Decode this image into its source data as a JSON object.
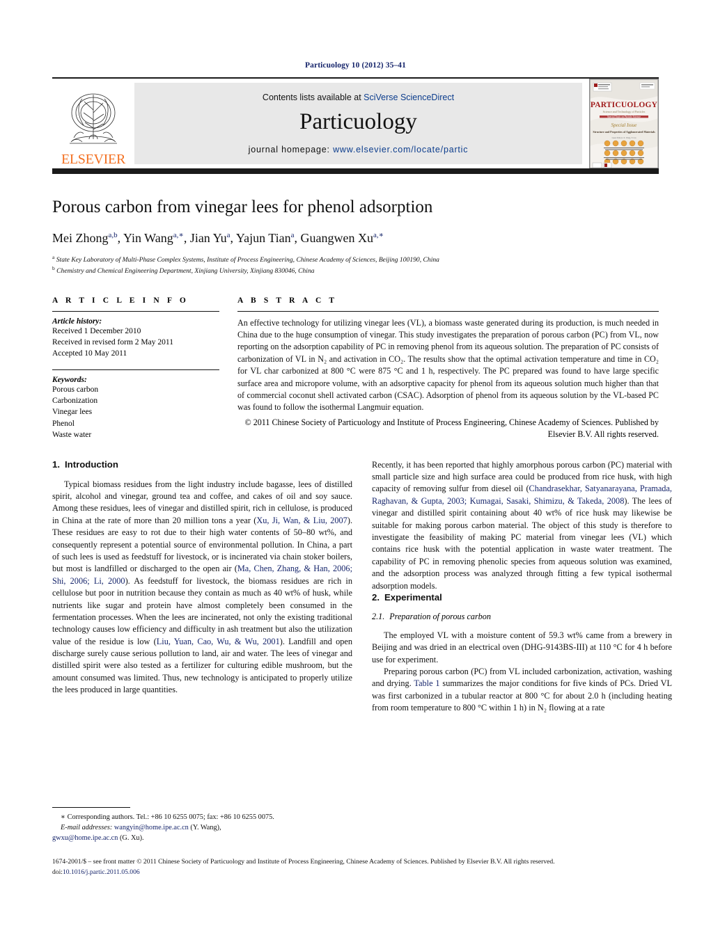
{
  "running_head": "Particuology 10 (2012) 35–41",
  "masthead": {
    "publisher_name": "ELSEVIER",
    "contents_prefix": "Contents lists available at ",
    "contents_link": "SciVerse ScienceDirect",
    "journal_title": "Particuology",
    "homepage_prefix": "journal homepage:",
    "homepage_url": "www.elsevier.com/locate/partic",
    "cover_title": "PARTICUOLOGY",
    "cover_subtitle": "Science and Technology of Particles",
    "cover_issue_label": "Special Issue"
  },
  "article": {
    "title": "Porous carbon from vinegar lees for phenol adsorption",
    "authors": [
      {
        "name": "Mei Zhong",
        "sup": "a,b"
      },
      {
        "name": "Yin Wang",
        "sup": "a,∗"
      },
      {
        "name": "Jian Yu",
        "sup": "a"
      },
      {
        "name": "Yajun Tian",
        "sup": "a"
      },
      {
        "name": "Guangwen Xu",
        "sup": "a,∗"
      }
    ],
    "affiliations": [
      {
        "marker": "a",
        "text": "State Key Laboratory of Multi-Phase Complex Systems, Institute of Process Engineering, Chinese Academy of Sciences, Beijing 100190, China"
      },
      {
        "marker": "b",
        "text": "Chemistry and Chemical Engineering Department, Xinjiang University, Xinjiang 830046, China"
      }
    ]
  },
  "article_info": {
    "heading": "A R T I C L E    I N F O",
    "history_label": "Article history:",
    "history": [
      "Received 1 December 2010",
      "Received in revised form 2 May 2011",
      "Accepted 10 May 2011"
    ],
    "keywords_label": "Keywords:",
    "keywords": [
      "Porous carbon",
      "Carbonization",
      "Vinegar lees",
      "Phenol",
      "Waste water"
    ]
  },
  "abstract": {
    "heading": "A B S T R A C T",
    "body": "An effective technology for utilizing vinegar lees (VL), a biomass waste generated during its production, is much needed in China due to the huge consumption of vinegar. This study investigates the preparation of porous carbon (PC) from VL, now reporting on the adsorption capability of PC in removing phenol from its aqueous solution. The preparation of PC consists of carbonization of VL in N₂ and activation in CO₂. The results show that the optimal activation temperature and time in CO₂ for VL char carbonized at 800 °C were 875 °C and 1 h, respectively. The PC prepared was found to have large specific surface area and micropore volume, with an adsorptive capacity for phenol from its aqueous solution much higher than that of commercial coconut shell activated carbon (CSAC). Adsorption of phenol from its aqueous solution by the VL-based PC was found to follow the isothermal Langmuir equation.",
    "copyright": "© 2011 Chinese Society of Particuology and Institute of Process Engineering, Chinese Academy of Sciences. Published by Elsevier B.V. All rights reserved."
  },
  "sections": {
    "introduction": {
      "number": "1.",
      "heading": "Introduction",
      "para1_a": "Typical biomass residues from the light industry include bagasse, lees of distilled spirit, alcohol and vinegar, ground tea and coffee, and cakes of oil and soy sauce. Among these residues, lees of vinegar and distilled spirit, rich in cellulose, is produced in China at the rate of more than 20 million tons a year (",
      "cite1": "Xu, Ji, Wan, & Liu, 2007",
      "para1_b": "). These residues are easy to rot due to their high water contents of 50–80 wt%, and consequently represent a potential source of environmental pollution. In China, a part of such lees is used as feedstuff for livestock, or is incinerated via chain stoker boilers, but most is landfilled or discharged to the open air (",
      "cite2": "Ma, Chen, Zhang, & Han, 2006; Shi, 2006; Li, 2000",
      "para1_c": "). As feedstuff for livestock, the biomass residues are rich in cellulose but poor in nutrition because they contain as much as 40 wt% of husk, while nutrients like sugar and protein have almost completely been consumed in the fermentation processes. When the lees are incinerated, not only the existing traditional technology causes low efficiency and difficulty in ash treatment but also the utilization value of the residue is low (",
      "cite3": "Liu, Yuan, Cao, Wu, & Wu, 2001",
      "para1_d": "). Landfill and open discharge surely cause serious pollution to land, air and water. The lees of vinegar and distilled spirit were also tested as a fertilizer for culturing edible mushroom, but the amount consumed was limited. Thus, new technology is anticipated to properly utilize the lees produced in large quantities.",
      "para2_a": "Recently, it has been reported that highly amorphous porous carbon (PC) material with small particle size and high surface area could be produced from rice husk, with high capacity of removing sulfur from diesel oil (",
      "cite4": "Chandrasekhar, Satyanarayana, Pramada, Raghavan, & Gupta, 2003; Kumagai, Sasaki, Shimizu, & Takeda, 2008",
      "para2_b": "). The lees of vinegar and distilled spirit containing about 40 wt% of rice husk may likewise be suitable for making porous carbon material. The object of this study is therefore to investigate the feasibility of making PC material from vinegar lees (VL) which contains rice husk with the potential application in waste water treatment. The capability of PC in removing phenolic species from aqueous solution was examined, and the adsorption process was analyzed through fitting a few typical isothermal adsorption models."
    },
    "experimental": {
      "number": "2.",
      "heading": "Experimental",
      "sub_number": "2.1.",
      "sub_heading": "Preparation of porous carbon",
      "para1": "The employed VL with a moisture content of 59.3 wt% came from a brewery in Beijing and was dried in an electrical oven (DHG-9143BS-III) at 110 °C for 4 h before use for experiment.",
      "para2_a": "Preparing porous carbon (PC) from VL included carbonization, activation, washing and drying. ",
      "cite_table": "Table 1",
      "para2_b": " summarizes the major conditions for five kinds of PCs. Dried VL was first carbonized in a tubular reactor at 800 °C for about 2.0 h (including heating from room temperature to 800 °C within 1 h) in N₂ flowing at a rate"
    }
  },
  "footnote": {
    "corresponding": "∗ Corresponding authors. Tel.: +86 10 6255 0075; fax: +86 10 6255 0075.",
    "email_label": "E-mail addresses:",
    "email1": "wangyin@home.ipe.ac.cn",
    "email1_owner": " (Y. Wang),",
    "email2": "gwxu@home.ipe.ac.cn",
    "email2_owner": " (G. Xu)."
  },
  "footer": {
    "line1": "1674-2001/$ – see front matter © 2011 Chinese Society of Particuology and Institute of Process Engineering, Chinese Academy of Sciences. Published by Elsevier B.V. All rights reserved.",
    "doi_label": "doi:",
    "doi": "10.1016/j.partic.2011.05.006"
  },
  "colors": {
    "link_blue": "#16256b",
    "elsevier_orange": "#f37021",
    "band_gray": "#e8e8e8"
  }
}
